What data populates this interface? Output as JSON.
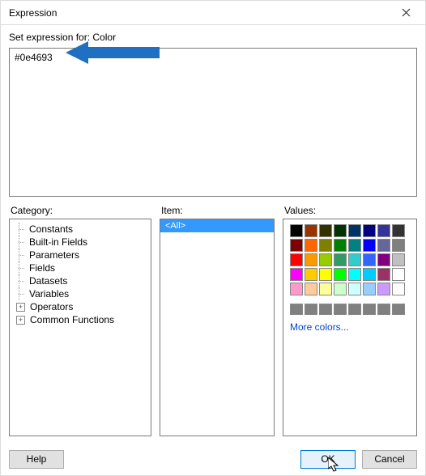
{
  "titlebar": {
    "title": "Expression"
  },
  "subtitle": "Set expression for: Color",
  "expression": {
    "value": "#0e4693"
  },
  "panes": {
    "category_label": "Category:",
    "item_label": "Item:",
    "values_label": "Values:"
  },
  "categories": [
    {
      "label": "Constants",
      "expand": null
    },
    {
      "label": "Built-in Fields",
      "expand": null
    },
    {
      "label": "Parameters",
      "expand": null
    },
    {
      "label": "Fields",
      "expand": null
    },
    {
      "label": "Datasets",
      "expand": null
    },
    {
      "label": "Variables",
      "expand": null
    },
    {
      "label": "Operators",
      "expand": "+"
    },
    {
      "label": "Common Functions",
      "expand": "+"
    }
  ],
  "items": [
    {
      "label": "<All>",
      "selected": true
    }
  ],
  "values": {
    "colors": [
      "#000000",
      "#993300",
      "#333300",
      "#003300",
      "#003366",
      "#000080",
      "#333399",
      "#333333",
      "#800000",
      "#ff6600",
      "#808000",
      "#008000",
      "#008080",
      "#0000ff",
      "#666699",
      "#808080",
      "#ff0000",
      "#ff9900",
      "#99cc00",
      "#339966",
      "#33cccc",
      "#3366ff",
      "#800080",
      "#c0c0c0",
      "#ff00ff",
      "#ffcc00",
      "#ffff00",
      "#00ff00",
      "#00ffff",
      "#00ccff",
      "#993366",
      "#ffffff",
      "#ff99cc",
      "#ffcc99",
      "#ffff99",
      "#ccffcc",
      "#ccffff",
      "#99ccff",
      "#cc99ff",
      "#ffffff"
    ],
    "gray_row_count": 8,
    "more_label": "More colors..."
  },
  "footer": {
    "help": "Help",
    "ok": "OK",
    "cancel": "Cancel"
  }
}
